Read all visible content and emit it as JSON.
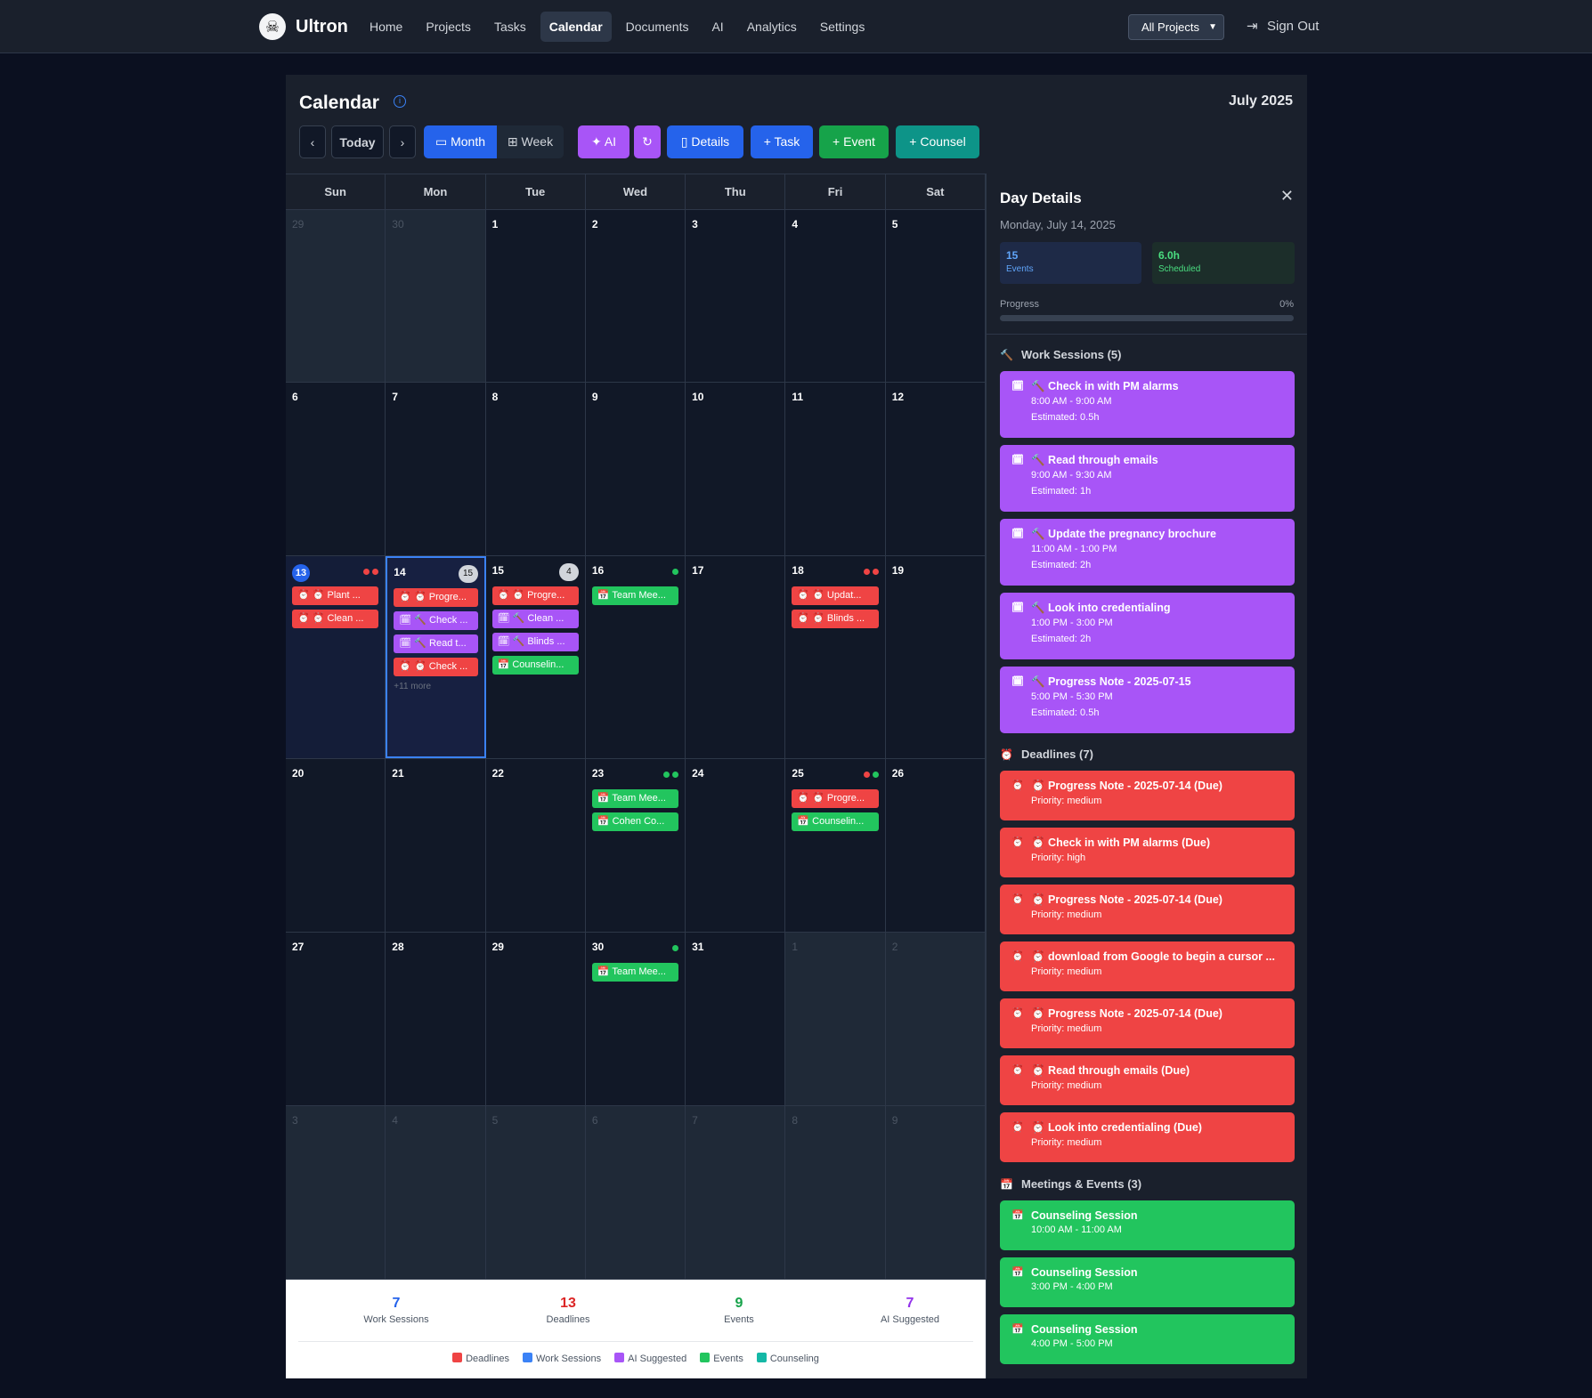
{
  "nav": {
    "brand": "Ultron",
    "links": [
      "Home",
      "Projects",
      "Tasks",
      "Calendar",
      "Documents",
      "AI",
      "Analytics",
      "Settings"
    ],
    "project_select": "All Projects",
    "sign_out": "Sign Out"
  },
  "header": {
    "title": "Calendar",
    "month_label": "July 2025"
  },
  "toolbar": {
    "today": "Today",
    "month": "Month",
    "week": "Week",
    "ai": "AI",
    "details": "Details",
    "task": "Task",
    "event": "Event",
    "counsel": "Counsel"
  },
  "days_of_week": [
    "Sun",
    "Mon",
    "Tue",
    "Wed",
    "Thu",
    "Fri",
    "Sat"
  ],
  "weeks": [
    [
      {
        "d": "29",
        "other": true
      },
      {
        "d": "30",
        "other": true
      },
      {
        "d": "1"
      },
      {
        "d": "2"
      },
      {
        "d": "3"
      },
      {
        "d": "4"
      },
      {
        "d": "5"
      }
    ],
    [
      {
        "d": "6"
      },
      {
        "d": "7"
      },
      {
        "d": "8"
      },
      {
        "d": "9"
      },
      {
        "d": "10"
      },
      {
        "d": "11"
      },
      {
        "d": "12"
      }
    ],
    [
      {
        "d": "13",
        "today": true,
        "dots": [
          "#ef4444",
          "#ef4444"
        ],
        "events": [
          {
            "c": "red",
            "t": "⏰ ⏰ Plant ..."
          },
          {
            "c": "red",
            "t": "⏰ ⏰ Clean ..."
          }
        ]
      },
      {
        "d": "14",
        "selected": true,
        "count": "15",
        "events": [
          {
            "c": "red",
            "t": "⏰ ⏰ Progre..."
          },
          {
            "c": "purple",
            "t": "🗓 🔨 Check ..."
          },
          {
            "c": "purple",
            "t": "🗓 🔨 Read t..."
          },
          {
            "c": "red",
            "t": "⏰ ⏰ Check ..."
          }
        ],
        "more": "+11 more"
      },
      {
        "d": "15",
        "count": "4",
        "events": [
          {
            "c": "red",
            "t": "⏰ ⏰ Progre..."
          },
          {
            "c": "purple",
            "t": "🗓 🔨 Clean ..."
          },
          {
            "c": "purple",
            "t": "🗓 🔨 Blinds ..."
          },
          {
            "c": "green",
            "t": "📅 Counselin..."
          }
        ]
      },
      {
        "d": "16",
        "dots": [
          "#22c55e"
        ],
        "events": [
          {
            "c": "green",
            "t": "📅 Team Mee..."
          }
        ]
      },
      {
        "d": "17"
      },
      {
        "d": "18",
        "dots": [
          "#ef4444",
          "#ef4444"
        ],
        "events": [
          {
            "c": "red",
            "t": "⏰ ⏰ Updat..."
          },
          {
            "c": "red",
            "t": "⏰ ⏰ Blinds ..."
          }
        ]
      },
      {
        "d": "19"
      }
    ],
    [
      {
        "d": "20"
      },
      {
        "d": "21"
      },
      {
        "d": "22"
      },
      {
        "d": "23",
        "dots": [
          "#22c55e",
          "#22c55e"
        ],
        "events": [
          {
            "c": "green",
            "t": "📅 Team Mee..."
          },
          {
            "c": "green",
            "t": "📅 Cohen Co..."
          }
        ]
      },
      {
        "d": "24"
      },
      {
        "d": "25",
        "dots": [
          "#ef4444",
          "#22c55e"
        ],
        "events": [
          {
            "c": "red",
            "t": "⏰ ⏰ Progre..."
          },
          {
            "c": "green",
            "t": "📅 Counselin..."
          }
        ]
      },
      {
        "d": "26"
      }
    ],
    [
      {
        "d": "27"
      },
      {
        "d": "28"
      },
      {
        "d": "29"
      },
      {
        "d": "30",
        "dots": [
          "#22c55e"
        ],
        "events": [
          {
            "c": "green",
            "t": "📅 Team Mee..."
          }
        ]
      },
      {
        "d": "31"
      },
      {
        "d": "1",
        "other": true
      },
      {
        "d": "2",
        "other": true
      }
    ],
    [
      {
        "d": "3",
        "other": true
      },
      {
        "d": "4",
        "other": true
      },
      {
        "d": "5",
        "other": true
      },
      {
        "d": "6",
        "other": true
      },
      {
        "d": "7",
        "other": true
      },
      {
        "d": "8",
        "other": true
      },
      {
        "d": "9",
        "other": true
      }
    ]
  ],
  "stats": [
    {
      "value": "7",
      "label": "Work Sessions",
      "color": "#2563eb"
    },
    {
      "value": "13",
      "label": "Deadlines",
      "color": "#dc2626"
    },
    {
      "value": "9",
      "label": "Events",
      "color": "#16a34a"
    },
    {
      "value": "7",
      "label": "AI Suggested",
      "color": "#9333ea"
    }
  ],
  "legend": [
    {
      "label": "Deadlines",
      "color": "#ef4444"
    },
    {
      "label": "Work Sessions",
      "color": "#3b82f6"
    },
    {
      "label": "AI Suggested",
      "color": "#a855f7"
    },
    {
      "label": "Events",
      "color": "#22c55e"
    },
    {
      "label": "Counseling",
      "color": "#14b8a6"
    }
  ],
  "day_details": {
    "title": "Day Details",
    "date": "Monday, July 14, 2025",
    "events_count": "15",
    "events_label": "Events",
    "scheduled": "6.0h",
    "scheduled_label": "Scheduled",
    "progress_label": "Progress",
    "progress_value": "0%",
    "progress_fraction": 0,
    "work_sessions_title": "Work Sessions (5)",
    "work_sessions": [
      {
        "title": "Check in with PM alarms",
        "time": "8:00 AM - 9:00 AM",
        "est": "Estimated: 0.5h"
      },
      {
        "title": "Read through emails",
        "time": "9:00 AM - 9:30 AM",
        "est": "Estimated: 1h"
      },
      {
        "title": "Update the pregnancy brochure",
        "time": "11:00 AM - 1:00 PM",
        "est": "Estimated: 2h"
      },
      {
        "title": "Look into credentialing",
        "time": "1:00 PM - 3:00 PM",
        "est": "Estimated: 2h"
      },
      {
        "title": "Progress Note - 2025-07-15",
        "time": "5:00 PM - 5:30 PM",
        "est": "Estimated: 0.5h"
      }
    ],
    "deadlines_title": "Deadlines (7)",
    "deadlines": [
      {
        "title": "Progress Note - 2025-07-14 (Due)",
        "priority": "Priority: medium"
      },
      {
        "title": "Check in with PM alarms (Due)",
        "priority": "Priority: high"
      },
      {
        "title": "Progress Note - 2025-07-14 (Due)",
        "priority": "Priority: medium"
      },
      {
        "title": "download from Google to begin a cursor ...",
        "priority": "Priority: medium"
      },
      {
        "title": "Progress Note - 2025-07-14 (Due)",
        "priority": "Priority: medium"
      },
      {
        "title": "Read through emails (Due)",
        "priority": "Priority: medium"
      },
      {
        "title": "Look into credentialing (Due)",
        "priority": "Priority: medium"
      }
    ],
    "meetings_title": "Meetings & Events (3)",
    "meetings": [
      {
        "title": "Counseling Session",
        "time": "10:00 AM - 11:00 AM"
      },
      {
        "title": "Counseling Session",
        "time": "3:00 PM - 4:00 PM"
      },
      {
        "title": "Counseling Session",
        "time": "4:00 PM - 5:00 PM"
      }
    ]
  }
}
